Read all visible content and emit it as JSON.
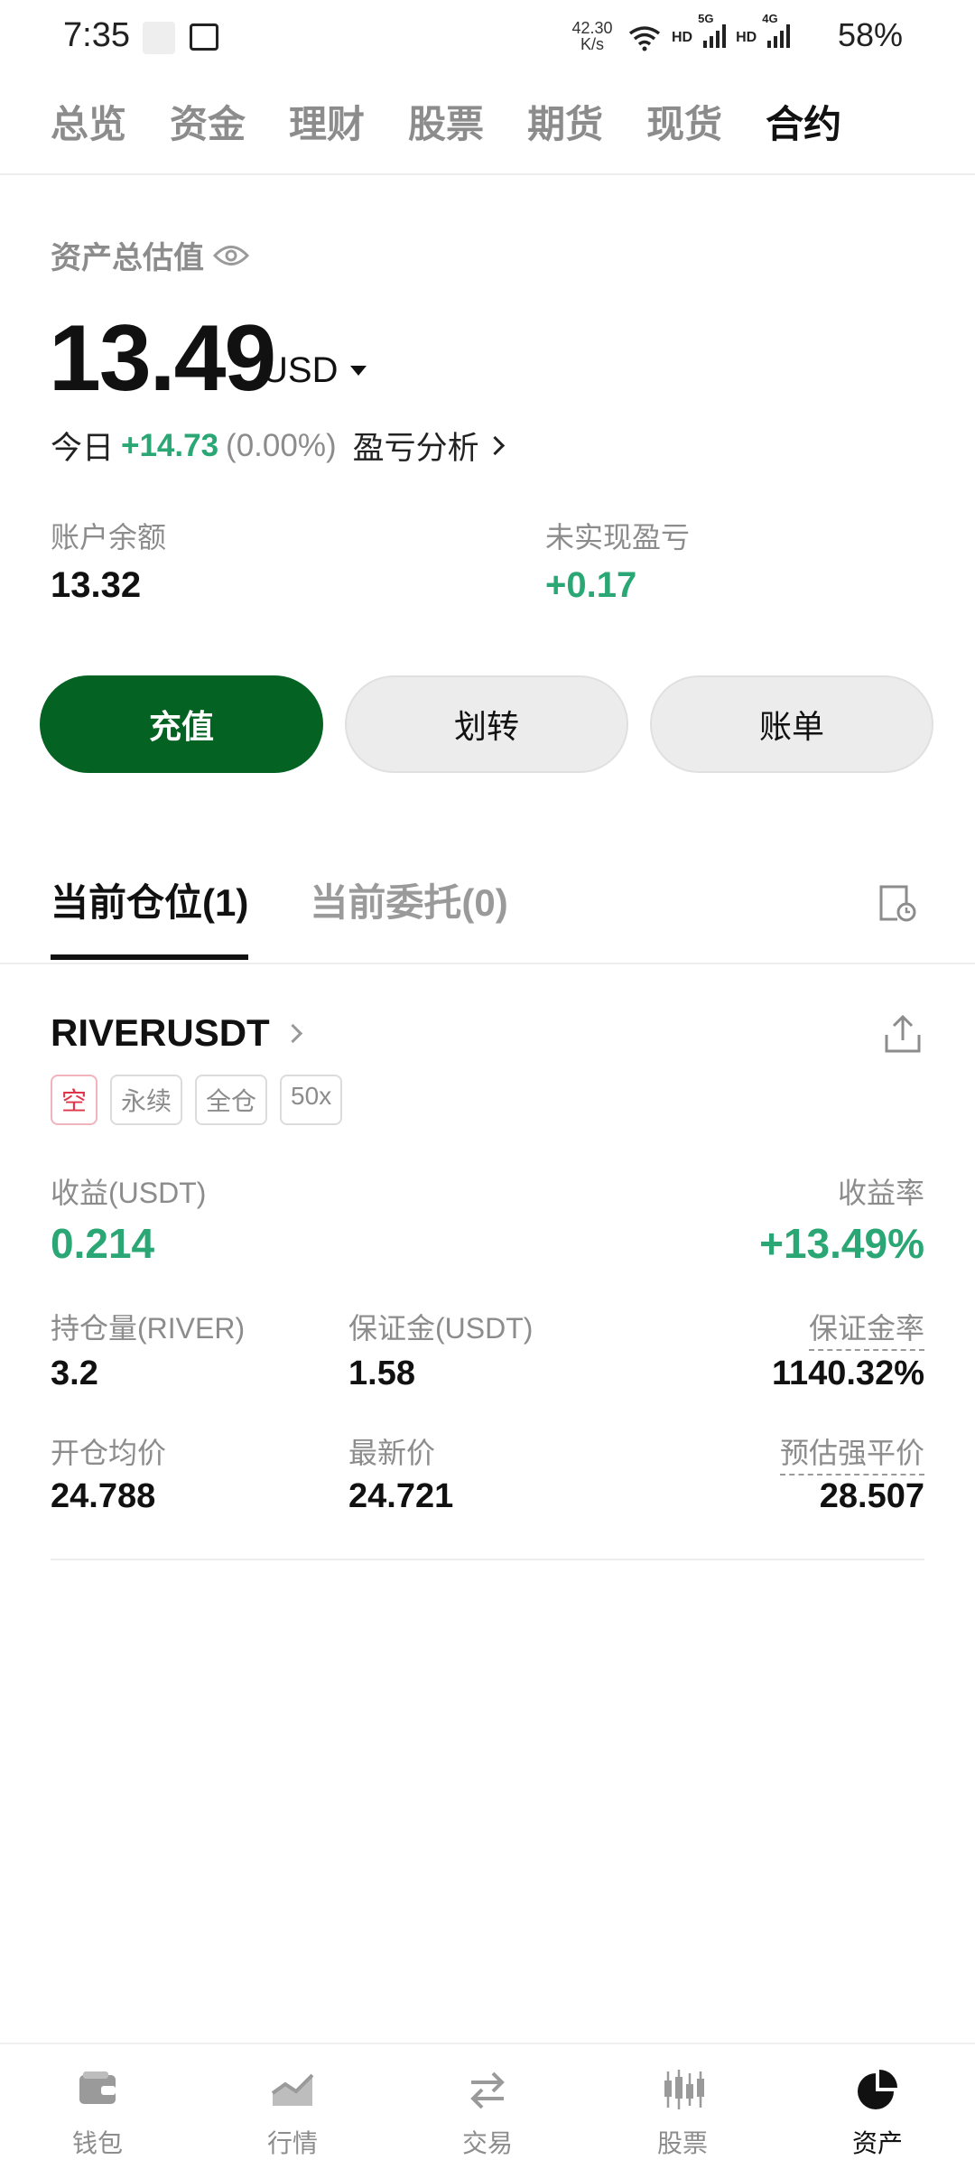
{
  "status_bar": {
    "time": "7:35",
    "speed_value": "42.30",
    "speed_unit": "K/s",
    "hd1": "HD",
    "net1": "5G",
    "hd2": "HD",
    "net2": "4G",
    "battery": "58%"
  },
  "top_tabs": [
    {
      "label": "总览",
      "active": false
    },
    {
      "label": "资金",
      "active": false
    },
    {
      "label": "理财",
      "active": false
    },
    {
      "label": "股票",
      "active": false
    },
    {
      "label": "期货",
      "active": false
    },
    {
      "label": "现货",
      "active": false
    },
    {
      "label": "合约",
      "active": true
    }
  ],
  "summary": {
    "label": "资产总估值",
    "value": "13.49",
    "currency": "USD",
    "today_label": "今日",
    "today_pnl": "+14.73",
    "today_pct": "(0.00%)",
    "pnl_link": "盈亏分析",
    "balance_label": "账户余额",
    "balance_value": "13.32",
    "unrealized_label": "未实现盈亏",
    "unrealized_value": "+0.17"
  },
  "actions": {
    "deposit": "充值",
    "transfer": "划转",
    "bill": "账单"
  },
  "position_tabs": [
    {
      "label": "当前仓位",
      "count": "(1)",
      "active": true
    },
    {
      "label": "当前委托",
      "count": "(0)",
      "active": false
    }
  ],
  "position": {
    "symbol": "RIVERUSDT",
    "tags": [
      "空",
      "永续",
      "全仓",
      "50x"
    ],
    "pnl_label": "收益(USDT)",
    "pnl_value": "0.214",
    "roi_label": "收益率",
    "roi_value": "+13.49%",
    "size_label": "持仓量(RIVER)",
    "size_value": "3.2",
    "margin_label": "保证金(USDT)",
    "margin_value": "1.58",
    "margin_ratio_label": "保证金率",
    "margin_ratio_value": "1140.32%",
    "entry_label": "开仓均价",
    "entry_value": "24.788",
    "last_label": "最新价",
    "last_value": "24.721",
    "liq_label": "预估强平价",
    "liq_value": "28.507"
  },
  "bottom_nav": [
    {
      "label": "钱包",
      "icon": "wallet-icon",
      "active": false
    },
    {
      "label": "行情",
      "icon": "market-chart-icon",
      "active": false
    },
    {
      "label": "交易",
      "icon": "trade-arrows-icon",
      "active": false
    },
    {
      "label": "股票",
      "icon": "stock-candles-icon",
      "active": false
    },
    {
      "label": "资产",
      "icon": "assets-pie-icon",
      "active": true
    }
  ],
  "colors": {
    "primary_green": "#046222",
    "profit_green": "#2aa774",
    "short_red": "#e0344a"
  }
}
